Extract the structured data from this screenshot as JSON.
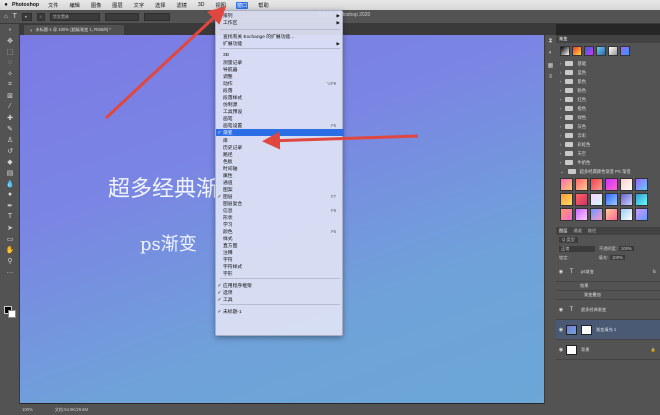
{
  "menubar": {
    "apple": "",
    "app": "Photoshop",
    "items": [
      "文件",
      "编辑",
      "图像",
      "图层",
      "文字",
      "选择",
      "滤镜",
      "3D",
      "视图",
      "窗口",
      "帮助"
    ],
    "active_index": 9
  },
  "window_title": "Adobe Photoshop 2020",
  "optbar": {
    "tool_icon": "T",
    "font_box": "华文黑体"
  },
  "doc_tab": {
    "label": "未标题-1 @ 100% (超级渐变 1, RGB/8) *"
  },
  "canvas": {
    "text1": "超多经典渐",
    "text2": "ps渐变"
  },
  "statusbar": {
    "zoom": "100%",
    "docinfo": "文档:54.9K/29.6M"
  },
  "menu": {
    "items": [
      {
        "label": "排列",
        "arrow": "▶",
        "check": "",
        "shortcut": ""
      },
      {
        "label": "工作区",
        "arrow": "▶",
        "check": "",
        "shortcut": ""
      },
      {
        "label": "查找有关 Exchange 的扩展功能...",
        "arrow": "",
        "check": "",
        "shortcut": ""
      },
      {
        "label": "扩展功能",
        "arrow": "▶",
        "check": "",
        "shortcut": ""
      },
      {
        "label": "3D",
        "arrow": "",
        "check": "",
        "shortcut": ""
      },
      {
        "label": "测量记录",
        "arrow": "",
        "check": "",
        "shortcut": ""
      },
      {
        "label": "导航器",
        "arrow": "",
        "check": "",
        "shortcut": ""
      },
      {
        "label": "调整",
        "arrow": "",
        "check": "",
        "shortcut": ""
      },
      {
        "label": "动作",
        "arrow": "",
        "check": "",
        "shortcut": "⌥F9"
      },
      {
        "label": "段落",
        "arrow": "",
        "check": "",
        "shortcut": ""
      },
      {
        "label": "段落样式",
        "arrow": "",
        "check": "",
        "shortcut": ""
      },
      {
        "label": "仿制源",
        "arrow": "",
        "check": "",
        "shortcut": ""
      },
      {
        "label": "工具预设",
        "arrow": "",
        "check": "",
        "shortcut": ""
      },
      {
        "label": "画笔",
        "arrow": "",
        "check": "",
        "shortcut": ""
      },
      {
        "label": "画笔设置",
        "arrow": "",
        "check": "",
        "shortcut": "F5"
      },
      {
        "label": "渐变",
        "arrow": "",
        "check": "✓",
        "shortcut": ""
      },
      {
        "label": "库",
        "arrow": "",
        "check": "",
        "shortcut": ""
      },
      {
        "label": "历史记录",
        "arrow": "",
        "check": "",
        "shortcut": ""
      },
      {
        "label": "路径",
        "arrow": "",
        "check": "",
        "shortcut": ""
      },
      {
        "label": "色板",
        "arrow": "",
        "check": "",
        "shortcut": ""
      },
      {
        "label": "时间轴",
        "arrow": "",
        "check": "",
        "shortcut": ""
      },
      {
        "label": "属性",
        "arrow": "",
        "check": "",
        "shortcut": ""
      },
      {
        "label": "通道",
        "arrow": "",
        "check": "",
        "shortcut": ""
      },
      {
        "label": "图案",
        "arrow": "",
        "check": "",
        "shortcut": ""
      },
      {
        "label": "图层",
        "arrow": "",
        "check": "✓",
        "shortcut": "F7"
      },
      {
        "label": "图层复合",
        "arrow": "",
        "check": "",
        "shortcut": ""
      },
      {
        "label": "信息",
        "arrow": "",
        "check": "",
        "shortcut": "F8"
      },
      {
        "label": "形状",
        "arrow": "",
        "check": "",
        "shortcut": ""
      },
      {
        "label": "学习",
        "arrow": "",
        "check": "",
        "shortcut": ""
      },
      {
        "label": "颜色",
        "arrow": "",
        "check": "",
        "shortcut": "F6"
      },
      {
        "label": "样式",
        "arrow": "",
        "check": "",
        "shortcut": ""
      },
      {
        "label": "直方图",
        "arrow": "",
        "check": "",
        "shortcut": ""
      },
      {
        "label": "注释",
        "arrow": "",
        "check": "",
        "shortcut": ""
      },
      {
        "label": "字符",
        "arrow": "",
        "check": "",
        "shortcut": ""
      },
      {
        "label": "字符样式",
        "arrow": "",
        "check": "",
        "shortcut": ""
      },
      {
        "label": "字形",
        "arrow": "",
        "check": "",
        "shortcut": ""
      },
      {
        "label": "应用程序框架",
        "arrow": "",
        "check": "✓",
        "shortcut": ""
      },
      {
        "label": "选项",
        "arrow": "",
        "check": "✓",
        "shortcut": ""
      },
      {
        "label": "工具",
        "arrow": "",
        "check": "✓",
        "shortcut": ""
      },
      {
        "label": "未标题-1",
        "arrow": "",
        "check": "✓",
        "shortcut": ""
      }
    ],
    "highlight_index": 15
  },
  "panels": {
    "gradient_tab": "渐变",
    "folders": [
      "基础",
      "蓝色",
      "紫色",
      "粉色",
      "红色",
      "橙色",
      "绿色",
      "灰色",
      "云彩",
      "彩虹色",
      "天空",
      "牛奶色"
    ],
    "preset_group": "超多经典颜色渐变 PS 渐变",
    "layers_tabs": [
      "图层",
      "通道",
      "路径"
    ],
    "kind_box": "Q 类型",
    "blend_mode": "正常",
    "opacity_label": "不透明度:",
    "opacity_value": "100%",
    "fill_label": "填充:",
    "fill_value": "100%",
    "lock_label": "锁定:",
    "layers": [
      {
        "name": "ps渐变",
        "type": "T"
      },
      {
        "name": "效果",
        "type": ""
      },
      {
        "name": "渐变叠加",
        "type": ""
      },
      {
        "name": "超多经典渐变",
        "type": "T"
      },
      {
        "name": "渐变填充 1",
        "type": "G"
      },
      {
        "name": "背景",
        "type": "B"
      }
    ],
    "selected_layer": 4
  },
  "colors": {
    "accent": "#2b6ee6",
    "arrow": "#e0483f"
  }
}
